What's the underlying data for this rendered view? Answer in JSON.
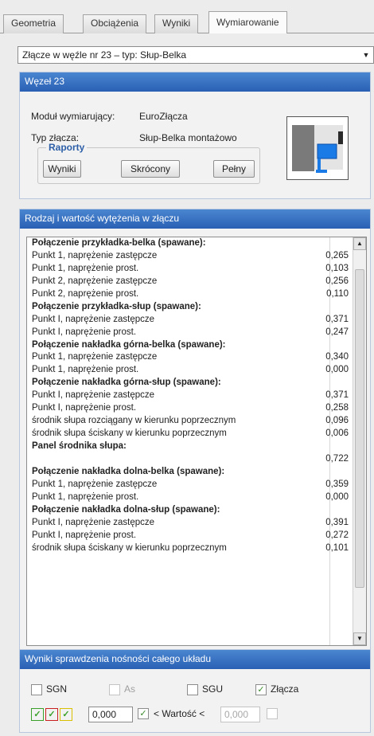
{
  "tabs": [
    {
      "label": "Geometria"
    },
    {
      "label": "Obciążenia"
    },
    {
      "label": "Wyniki"
    },
    {
      "label": "Wymiarowanie"
    }
  ],
  "active_tab": "Wymiarowanie",
  "joint_select": {
    "value": "Złącze w węźle nr 23 – typ: Słup-Belka"
  },
  "node_panel": {
    "title": "Węzeł 23",
    "module_label": "Moduł wymiarujący:",
    "module_value": "EuroZłącza",
    "type_label": "Typ złącza:",
    "type_value": "Słup-Belka montażowo",
    "reports_label": "Raporty",
    "buttons": {
      "results": "Wyniki",
      "short": "Skrócony",
      "full": "Pełny"
    }
  },
  "stress_panel": {
    "title": "Rodzaj i wartość wytężenia w złączu",
    "rows": [
      {
        "label": "Połączenie przykładka-belka (spawane):",
        "value": "",
        "header": true
      },
      {
        "label": "Punkt 1, naprężenie zastępcze",
        "value": "0,265",
        "header": false
      },
      {
        "label": "Punkt 1, naprężenie prost.",
        "value": "0,103",
        "header": false
      },
      {
        "label": "Punkt 2, naprężenie zastępcze",
        "value": "0,256",
        "header": false
      },
      {
        "label": "Punkt 2, naprężenie prost.",
        "value": "0,110",
        "header": false
      },
      {
        "label": "Połączenie przykładka-słup (spawane):",
        "value": "",
        "header": true
      },
      {
        "label": "Punkt I, naprężenie zastępcze",
        "value": "0,371",
        "header": false
      },
      {
        "label": "Punkt I, naprężenie prost.",
        "value": "0,247",
        "header": false
      },
      {
        "label": "Połączenie nakładka górna-belka (spawane):",
        "value": "",
        "header": true
      },
      {
        "label": "Punkt 1, naprężenie zastępcze",
        "value": "0,340",
        "header": false
      },
      {
        "label": "Punkt 1, naprężenie prost.",
        "value": "0,000",
        "header": false
      },
      {
        "label": "Połączenie nakładka górna-słup (spawane):",
        "value": "",
        "header": true
      },
      {
        "label": "Punkt I, naprężenie zastępcze",
        "value": "0,371",
        "header": false
      },
      {
        "label": "Punkt I, naprężenie prost.",
        "value": "0,258",
        "header": false
      },
      {
        "label": "środnik słupa rozciągany w kierunku poprzecznym",
        "value": "0,096",
        "header": false
      },
      {
        "label": "środnik słupa ściskany w kierunku poprzecznym",
        "value": "0,006",
        "header": false
      },
      {
        "label": "Panel środnika słupa:",
        "value": "",
        "header": true
      },
      {
        "label": "",
        "value": "0,722",
        "header": false
      },
      {
        "label": "Połączenie nakładka dolna-belka (spawane):",
        "value": "",
        "header": true
      },
      {
        "label": "Punkt 1, naprężenie zastępcze",
        "value": "0,359",
        "header": false
      },
      {
        "label": "Punkt 1, naprężenie prost.",
        "value": "0,000",
        "header": false
      },
      {
        "label": "Połączenie nakładka dolna-słup (spawane):",
        "value": "",
        "header": true
      },
      {
        "label": "Punkt I, naprężenie zastępcze",
        "value": "0,391",
        "header": false
      },
      {
        "label": "Punkt I, naprężenie prost.",
        "value": "0,272",
        "header": false
      },
      {
        "label": "środnik słupa ściskany w kierunku poprzecznym",
        "value": "0,101",
        "header": false
      }
    ]
  },
  "check_panel": {
    "title": "Wyniki sprawdzenia nośności całego układu",
    "options": [
      {
        "label": "SGN",
        "checked": false,
        "enabled": true
      },
      {
        "label": "As",
        "checked": false,
        "enabled": false
      },
      {
        "label": "SGU",
        "checked": false,
        "enabled": true
      },
      {
        "label": "Złącza",
        "checked": true,
        "enabled": true
      }
    ],
    "min_value": "0,000",
    "range_label": "< Wartość <",
    "max_value": "0,000"
  },
  "colors": {
    "panel_header": "#2f68b8",
    "status_green": "#3aa02a",
    "status_red": "#c82020",
    "status_yellow": "#d8c000"
  },
  "icons": [
    "check-icon",
    "chevron-down-icon",
    "scroll-up-icon",
    "scroll-down-icon"
  ]
}
